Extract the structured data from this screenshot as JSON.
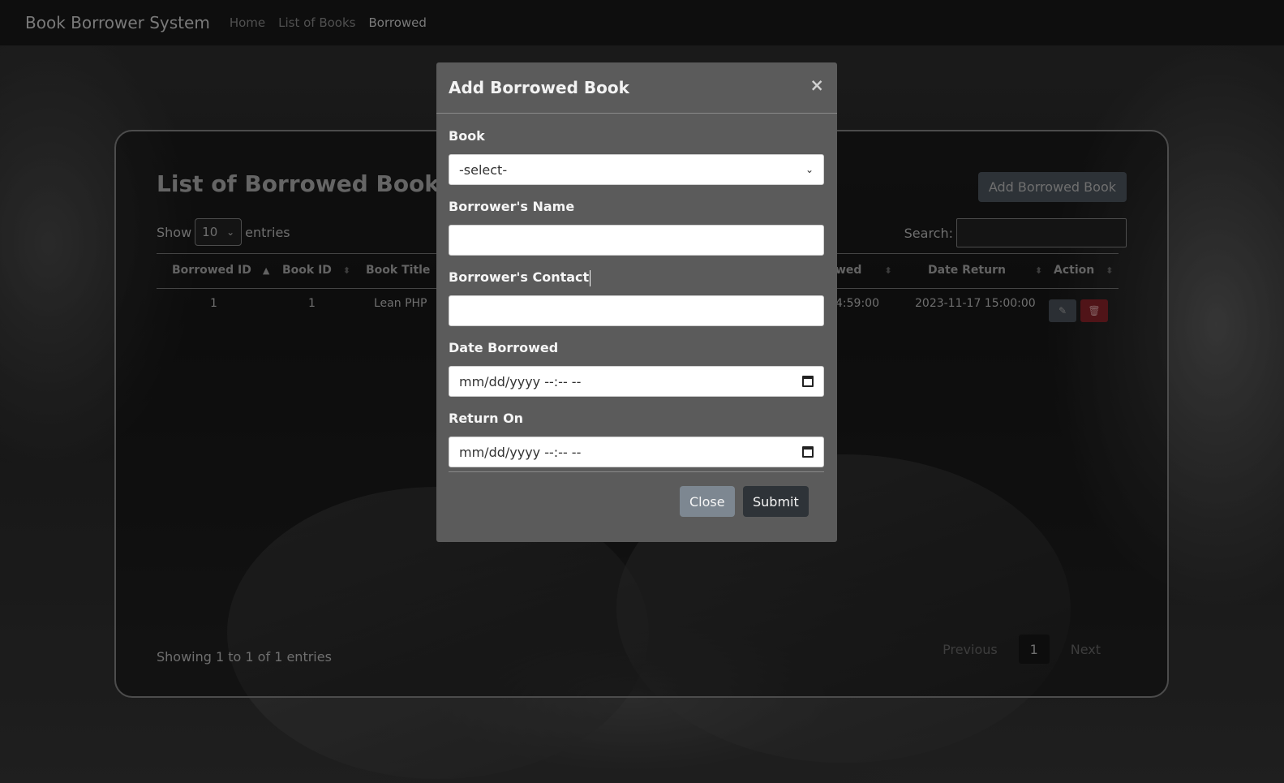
{
  "navbar": {
    "brand": "Book Borrower System",
    "links": [
      "Home",
      "List of Books",
      "Borrowed"
    ]
  },
  "card": {
    "title": "List of Borrowed Books",
    "add_button": "Add Borrowed Book",
    "length": {
      "show": "Show",
      "value": "10",
      "entries": "entries"
    },
    "search_label": "Search:",
    "columns": [
      "Borrowed ID",
      "Book ID",
      "Book Title",
      "wed",
      "Date Return",
      "Action"
    ],
    "rows": [
      {
        "borrowed_id": "1",
        "book_id": "1",
        "book_title": "Lean PHP",
        "date_borrowed_partial": "4:59:00",
        "date_return": "2023-11-17 15:00:00"
      }
    ],
    "info": "Showing 1 to 1 of 1 entries",
    "pagination": {
      "previous": "Previous",
      "current": "1",
      "next": "Next"
    }
  },
  "modal": {
    "title": "Add Borrowed Book",
    "close_symbol": "×",
    "fields": {
      "book_label": "Book",
      "book_value": "-select-",
      "name_label": "Borrower's Name",
      "contact_label": "Borrower's Contact",
      "date_borrowed_label": "Date Borrowed",
      "date_borrowed_value": "mm/dd/yyyy --:-- --",
      "return_label": "Return On",
      "return_value": "mm/dd/yyyy --:-- --"
    },
    "close_button": "Close",
    "submit_button": "Submit"
  },
  "colors": {
    "modal_bg": "#5b5b5b",
    "delete_button": "#6f1c22",
    "submit_button": "#2e3338",
    "close_button": "#7d8791"
  }
}
